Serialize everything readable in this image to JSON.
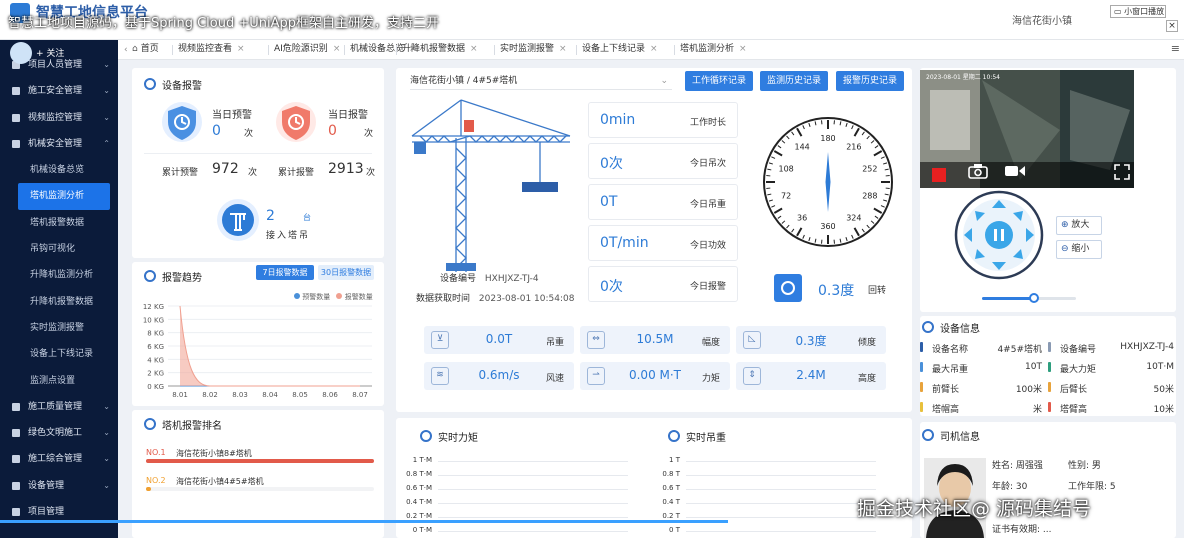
{
  "app": {
    "site_name": "智慧工地信息平台",
    "overlay_title": "智慧工地项目源码，基于Spring Cloud +UniApp框架自主研发，支持二开",
    "project": "海信花街小镇",
    "pip_label": "小窗口播放",
    "close_label": "×",
    "follow_label": "+ 关注",
    "watermark": "掘金技术社区@ 源码集结号"
  },
  "sidebar": {
    "items": [
      {
        "label": "项目人员管理",
        "type": "group",
        "arrow": "⌄"
      },
      {
        "label": "施工安全管理",
        "type": "group",
        "arrow": "⌄"
      },
      {
        "label": "视频监控管理",
        "type": "group",
        "arrow": "⌄"
      },
      {
        "label": "机械安全管理",
        "type": "group",
        "arrow": "⌃"
      },
      {
        "label": "机械设备总览",
        "type": "sub"
      },
      {
        "label": "塔机监测分析",
        "type": "sub",
        "active": true
      },
      {
        "label": "塔机报警数据",
        "type": "sub"
      },
      {
        "label": "吊钩可视化",
        "type": "sub"
      },
      {
        "label": "升降机监测分析",
        "type": "sub"
      },
      {
        "label": "升降机报警数据",
        "type": "sub"
      },
      {
        "label": "实时监测报警",
        "type": "sub"
      },
      {
        "label": "设备上下线记录",
        "type": "sub"
      },
      {
        "label": "监测点设置",
        "type": "sub"
      },
      {
        "label": "施工质量管理",
        "type": "group",
        "arrow": "⌄"
      },
      {
        "label": "绿色文明施工",
        "type": "group",
        "arrow": "⌄"
      },
      {
        "label": "施工综合管理",
        "type": "group",
        "arrow": "⌄"
      },
      {
        "label": "设备管理",
        "type": "group",
        "arrow": "⌄"
      },
      {
        "label": "项目管理",
        "type": "group",
        "arrow": ""
      }
    ]
  },
  "tabs": [
    {
      "label": "首页",
      "close": ""
    },
    {
      "label": "视频监控查看",
      "close": "×"
    },
    {
      "label": "AI危险源识别",
      "close": "×"
    },
    {
      "label": "机械设备总览",
      "close": "×"
    },
    {
      "label": "升降机报警数据",
      "close": "×"
    },
    {
      "label": "实时监测报警",
      "close": "×"
    },
    {
      "label": "设备上下线记录",
      "close": "×"
    },
    {
      "label": "塔机监测分析",
      "close": "×"
    }
  ],
  "tabs_menu_icon": "≡",
  "alarm": {
    "title": "设备报警",
    "today_warning_label": "当日预警",
    "today_warning_value": "0",
    "today_alarm_label": "当日报警",
    "today_alarm_value": "0",
    "unit": "次",
    "total_warning_label": "累计预警",
    "total_warning_value": "972",
    "total_alarm_label": "累计报警",
    "total_alarm_value": "2913",
    "tower_count": "2",
    "tower_count_unit": "台",
    "tower_label": "接入塔吊"
  },
  "trend": {
    "title": "报警趋势",
    "btn_7": "7日报警数据",
    "btn_30": "30日报警数据",
    "legend_warning": "预警数量",
    "legend_alarm": "报警数量",
    "warning_color": "#4a90d9",
    "alarm_color": "#f0a090"
  },
  "chart_data": {
    "type": "area",
    "categories": [
      "8.01",
      "8.02",
      "8.03",
      "8.04",
      "8.05",
      "8.06",
      "8.07"
    ],
    "ylim": [
      0,
      12
    ],
    "ytick_labels": [
      "12 KG",
      "10 KG",
      "8 KG",
      "6 KG",
      "4 KG",
      "2 KG",
      "0 KG"
    ],
    "series": [
      {
        "name": "预警数量",
        "values": [
          0,
          0,
          0,
          0,
          0,
          0,
          0
        ]
      },
      {
        "name": "报警数量",
        "values": [
          12,
          0,
          0,
          0,
          0,
          0,
          0
        ]
      }
    ]
  },
  "ranking": {
    "title": "塔机报警排名",
    "items": [
      {
        "rank": "NO.1",
        "name": "海信花街小镇8#塔机",
        "fill": 1.0,
        "color": "#e25a4a"
      },
      {
        "rank": "NO.2",
        "name": "海信花街小镇4#5#塔机",
        "fill": 0.02,
        "color": "#f0a030"
      }
    ]
  },
  "crane": {
    "selector": "海信花街小镇 / 4#5#塔机",
    "selector_arrow": "⌄",
    "btn_work": "工作循环记录",
    "btn_monitor": "监测历史记录",
    "btn_alarm": "报警历史记录",
    "device_no_label": "设备编号",
    "device_no": "HXHJXZ-TJ-4",
    "time_label": "数据获取时间",
    "time": "2023-08-01 10:54:08",
    "stats": [
      {
        "value": "0min",
        "label": "工作时长"
      },
      {
        "value": "0次",
        "label": "今日吊次"
      },
      {
        "value": "0T",
        "label": "今日吊重"
      },
      {
        "value": "0T/min",
        "label": "今日功效"
      },
      {
        "value": "0次",
        "label": "今日报警"
      }
    ],
    "compass_ticks": [
      "180",
      "216",
      "252",
      "288",
      "324",
      "360",
      "36",
      "72",
      "108",
      "144"
    ],
    "rotation_value": "0.3度",
    "rotation_label": "回转",
    "metrics": [
      {
        "icon": "⊻",
        "value": "0.0T",
        "label": "吊重"
      },
      {
        "icon": "⇔",
        "value": "10.5M",
        "label": "幅度"
      },
      {
        "icon": "◺",
        "value": "0.3度",
        "label": "倾度"
      },
      {
        "icon": "≋",
        "value": "0.6m/s",
        "label": "风速"
      },
      {
        "icon": "⇀",
        "value": "0.00 M·T",
        "label": "力矩"
      },
      {
        "icon": "⇕",
        "value": "2.4M",
        "label": "高度"
      }
    ]
  },
  "moment_chart": {
    "title": "实时力矩",
    "ticks": [
      "1 T·M",
      "0.8 T·M",
      "0.6 T·M",
      "0.4 T·M",
      "0.2 T·M",
      "0 T·M"
    ]
  },
  "weight_chart": {
    "title": "实时吊重",
    "ticks": [
      "1 T",
      "0.8 T",
      "0.6 T",
      "0.4 T",
      "0.2 T",
      "0 T"
    ]
  },
  "video": {
    "timestamp": "2023-08-01 星期二 10:54",
    "zoom_in": "放大",
    "zoom_out": "缩小",
    "slider_value": 0.55
  },
  "device_info": {
    "title": "设备信息",
    "rows": [
      {
        "label": "设备名称",
        "value": "4#5#塔机",
        "color": "#2d5ea8"
      },
      {
        "label": "设备编号",
        "value": "HXHJXZ-TJ-4",
        "color": "#8a9ab3"
      },
      {
        "label": "最大吊重",
        "value": "10T",
        "color": "#4a90d9"
      },
      {
        "label": "最大力矩",
        "value": "10T·M",
        "color": "#2e9e7e"
      },
      {
        "label": "前臂长",
        "value": "100米",
        "color": "#e8a33c"
      },
      {
        "label": "后臂长",
        "value": "50米",
        "color": "#e8a33c"
      },
      {
        "label": "塔帽高",
        "value": "米",
        "color": "#e8c03c"
      },
      {
        "label": "塔臂高",
        "value": "10米",
        "color": "#e25a4a"
      }
    ]
  },
  "driver": {
    "title": "司机信息",
    "name_label": "姓名:",
    "name": "周强强",
    "gender_label": "性别:",
    "gender": "男",
    "age_label": "年龄:",
    "age": "30",
    "years_label": "工作年限:",
    "years": "5",
    "cert_label": "证书有效期:",
    "cert": "..."
  }
}
